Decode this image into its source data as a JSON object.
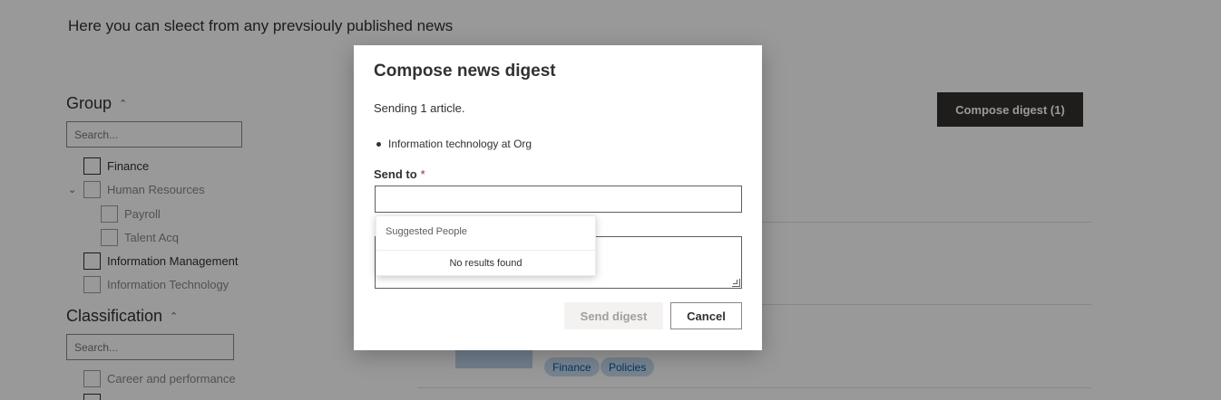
{
  "page": {
    "intro_text": "Here you can sleect from any prevsiouly published news",
    "compose_digest_button": "Compose digest (1)"
  },
  "filters": {
    "group": {
      "title": "Group",
      "search_placeholder": "Search...",
      "items": [
        {
          "label": "Finance"
        },
        {
          "label": "Human Resources"
        },
        {
          "label": "Payroll"
        },
        {
          "label": "Talent Acq"
        },
        {
          "label": "Information Management"
        },
        {
          "label": "Information Technology"
        }
      ]
    },
    "classification": {
      "title": "Classification",
      "search_placeholder": "Search...",
      "items": [
        {
          "label": "Career and performance"
        }
      ]
    }
  },
  "article_tags": [
    "Finance",
    "Policies"
  ],
  "dialog": {
    "title": "Compose news digest",
    "subtitle": "Sending 1 article.",
    "articles": [
      "Information technology at Org"
    ],
    "send_to_label": "Send to",
    "required_marker": "*",
    "send_to_value": "",
    "suggestions": {
      "header": "Suggested People",
      "empty_text": "No results found"
    },
    "send_button": "Send digest",
    "cancel_button": "Cancel"
  },
  "colors": {
    "primary_button": "#323130",
    "required": "#a4262c",
    "tag_bg": "#c7dcf0",
    "overlay": "rgba(0,0,0,0.4)"
  }
}
